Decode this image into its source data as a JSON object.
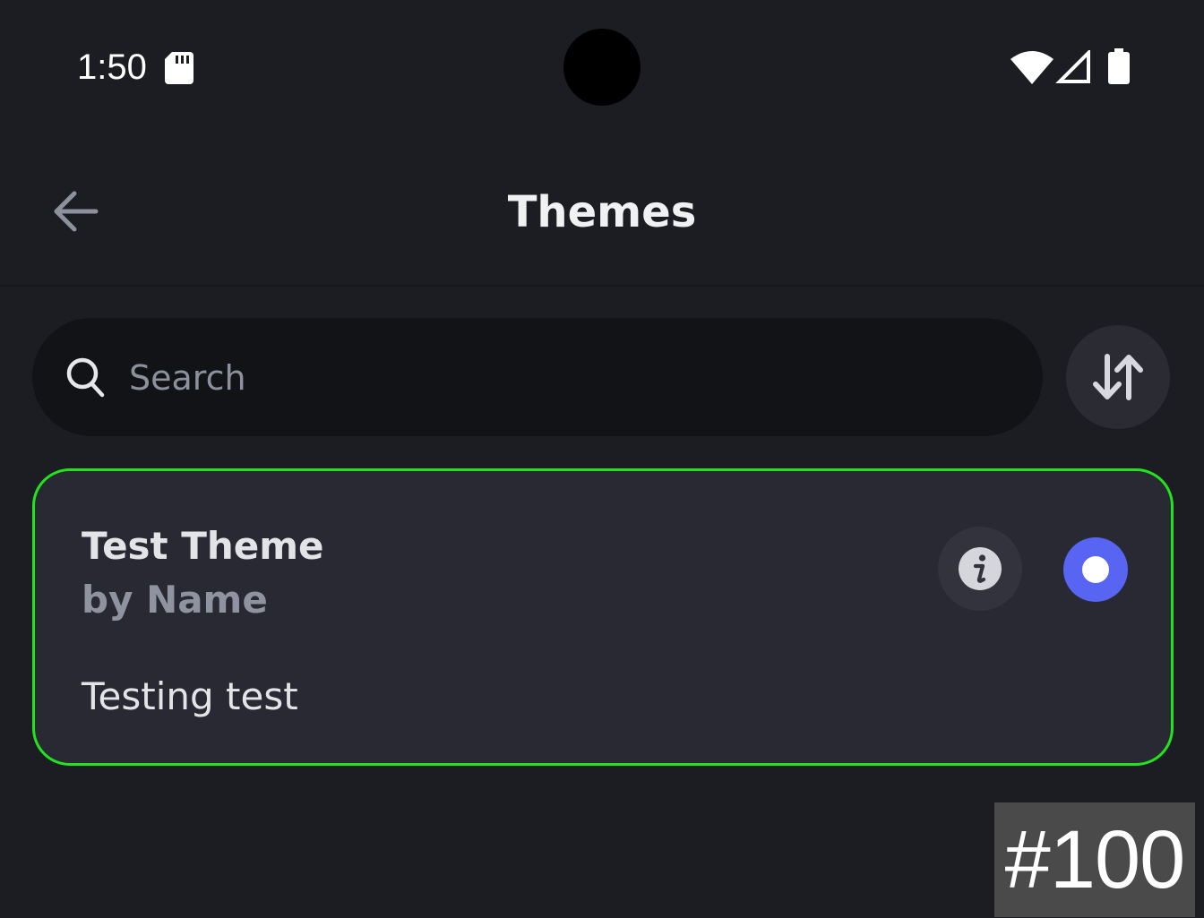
{
  "status_bar": {
    "time": "1:50",
    "icons": [
      "sd-card-icon",
      "wifi-icon",
      "cell-signal-icon",
      "battery-icon"
    ]
  },
  "header": {
    "title": "Themes",
    "back_icon": "arrow-left-icon"
  },
  "search": {
    "placeholder": "Search",
    "value": "",
    "icon": "search-icon"
  },
  "sort_button": {
    "icon": "sort-arrows-icon"
  },
  "themes": [
    {
      "name": "Test Theme",
      "author": "by Name",
      "description": "Testing test",
      "selected": true,
      "info_icon": "info-icon"
    }
  ],
  "badge": {
    "label": "#100"
  },
  "colors": {
    "background": "#1c1d23",
    "card": "#282933",
    "card_border": "#22e31e",
    "accent": "#5865f2",
    "search_bg": "#121317"
  }
}
